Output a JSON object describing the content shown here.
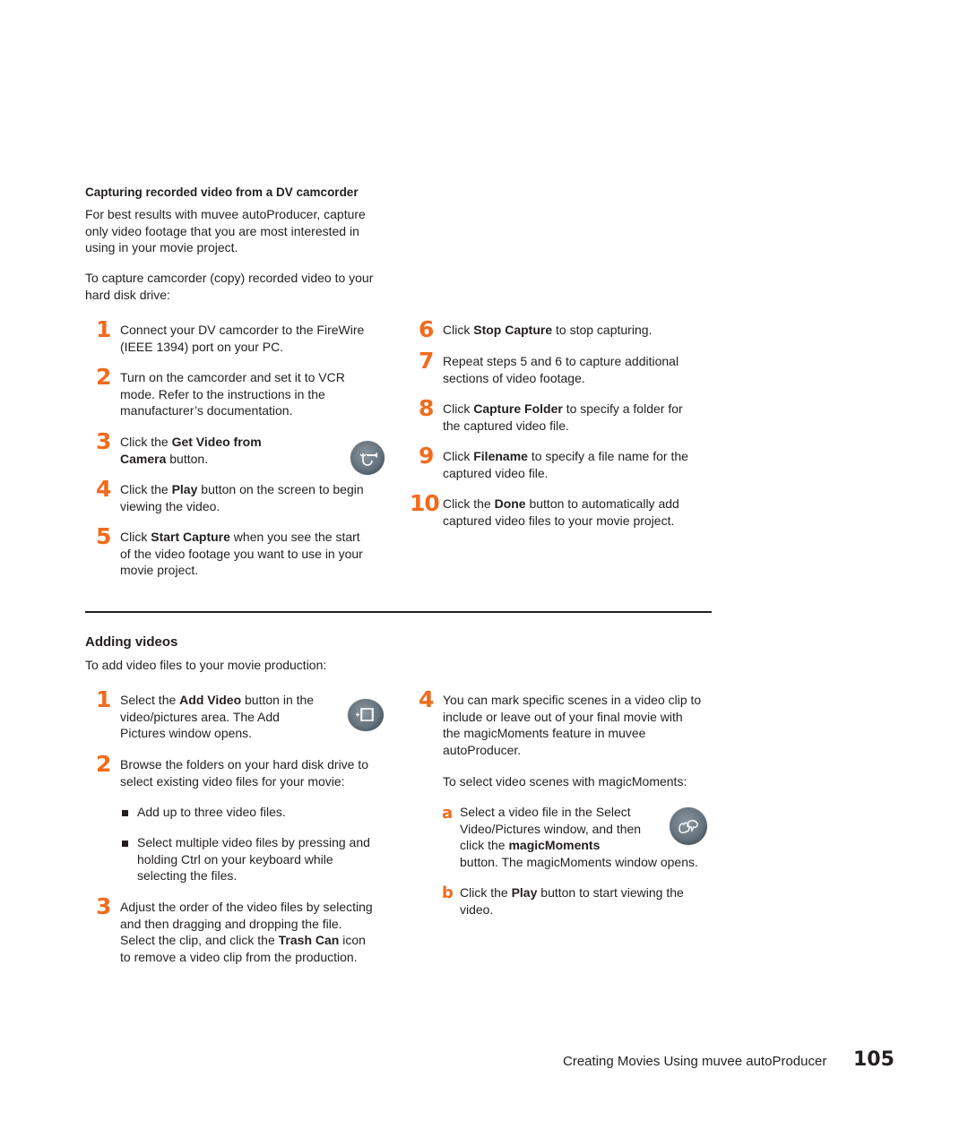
{
  "section1": {
    "heading": "Capturing recorded video from a DV camcorder",
    "intro_lines": [
      "For best results with muvee autoProducer, capture",
      "only video footage that you are most interested in",
      "using in your movie project."
    ],
    "lead_lines": [
      "To capture camcorder (copy) recorded video to your",
      "hard disk drive:"
    ],
    "steps": [
      {
        "num": "1",
        "lines": [
          [
            {
              "t": "Connect your DV camcorder to the FireWire"
            }
          ],
          [
            {
              "t": "(IEEE 1394) port on your PC."
            }
          ]
        ]
      },
      {
        "num": "2",
        "lines": [
          [
            {
              "t": "Turn on the camcorder and set it to VCR"
            }
          ],
          [
            {
              "t": "mode. Refer to the instructions in the"
            }
          ],
          [
            {
              "t": "manufacturer’s documentation."
            }
          ]
        ]
      },
      {
        "num": "3",
        "lines": [
          [
            {
              "t": "Click the "
            },
            {
              "t": "Get Video from",
              "b": true
            }
          ],
          [
            {
              "t": "Camera",
              "b": true
            },
            {
              "t": " button."
            }
          ]
        ]
      },
      {
        "num": "4",
        "lines": [
          [
            {
              "t": "Click the "
            },
            {
              "t": "Play",
              "b": true
            },
            {
              "t": " button on the screen to begin"
            }
          ],
          [
            {
              "t": "viewing the video."
            }
          ]
        ]
      },
      {
        "num": "5",
        "lines": [
          [
            {
              "t": "Click "
            },
            {
              "t": "Start Capture",
              "b": true
            },
            {
              "t": " when you see the start"
            }
          ],
          [
            {
              "t": "of the video footage you want to use in your"
            }
          ],
          [
            {
              "t": "movie project."
            }
          ]
        ]
      },
      {
        "num": "6",
        "lines": [
          [
            {
              "t": "Click "
            },
            {
              "t": "Stop Capture",
              "b": true
            },
            {
              "t": " to stop capturing."
            }
          ]
        ]
      },
      {
        "num": "7",
        "lines": [
          [
            {
              "t": "Repeat steps 5 and 6 to capture additional"
            }
          ],
          [
            {
              "t": "sections of video footage."
            }
          ]
        ]
      },
      {
        "num": "8",
        "lines": [
          [
            {
              "t": "Click "
            },
            {
              "t": "Capture Folder",
              "b": true
            },
            {
              "t": " to specify a folder for"
            }
          ],
          [
            {
              "t": "the captured video file."
            }
          ]
        ]
      },
      {
        "num": "9",
        "lines": [
          [
            {
              "t": "Click "
            },
            {
              "t": "Filename",
              "b": true
            },
            {
              "t": " to specify a file name for the"
            }
          ],
          [
            {
              "t": "captured video file."
            }
          ]
        ]
      },
      {
        "num": "10",
        "lines": [
          [
            {
              "t": "Click the "
            },
            {
              "t": "Done",
              "b": true
            },
            {
              "t": " button to automatically add"
            }
          ],
          [
            {
              "t": "captured video files to your movie project."
            }
          ]
        ]
      }
    ],
    "icon": "get-video-from-camera-icon"
  },
  "section2": {
    "heading": "Adding videos",
    "lead": "To add video files to your movie production:",
    "steps": [
      {
        "num": "1",
        "lines": [
          [
            {
              "t": "Select the "
            },
            {
              "t": "Add Video",
              "b": true
            },
            {
              "t": " button in the"
            }
          ],
          [
            {
              "t": "video/pictures area. The Add"
            }
          ],
          [
            {
              "t": "Pictures window opens."
            }
          ]
        ]
      },
      {
        "num": "2",
        "lines": [
          [
            {
              "t": "Browse the folders on your hard disk drive to"
            }
          ],
          [
            {
              "t": "select existing video files for your movie:"
            }
          ]
        ]
      },
      {
        "num": "3",
        "lines": [
          [
            {
              "t": "Adjust the order of the video files by selecting"
            }
          ],
          [
            {
              "t": "and then dragging and dropping the file."
            }
          ],
          [
            {
              "t": "Select the clip, and click the "
            },
            {
              "t": "Trash Can",
              "b": true
            },
            {
              "t": " icon"
            }
          ],
          [
            {
              "t": "to remove a video clip from the production."
            }
          ]
        ]
      },
      {
        "num": "4",
        "lines": [
          [
            {
              "t": "You can mark specific scenes in a video clip to"
            }
          ],
          [
            {
              "t": "include or leave out of your final movie with"
            }
          ],
          [
            {
              "t": "the magicMoments feature in muvee"
            }
          ],
          [
            {
              "t": "autoProducer."
            }
          ]
        ]
      }
    ],
    "bullets": [
      {
        "lines": [
          "Add up to three video files."
        ]
      },
      {
        "lines": [
          "Select multiple video files by pressing and",
          "holding Ctrl on your keyboard while",
          "selecting the files."
        ]
      }
    ],
    "magic_lead": "To select video scenes with magicMoments:",
    "substeps": [
      {
        "letter": "a",
        "lines": [
          [
            {
              "t": "Select a video file in the Select"
            }
          ],
          [
            {
              "t": "Video/Pictures window, and then"
            }
          ],
          [
            {
              "t": "click the "
            },
            {
              "t": "magicMoments",
              "b": true
            }
          ],
          [
            {
              "t": "button. The magicMoments window opens."
            }
          ]
        ]
      },
      {
        "letter": "b",
        "lines": [
          [
            {
              "t": "Click the "
            },
            {
              "t": "Play",
              "b": true
            },
            {
              "t": " button to start viewing the"
            }
          ],
          [
            {
              "t": "video."
            }
          ]
        ]
      }
    ],
    "icons": [
      "add-video-icon",
      "magic-moments-icon"
    ]
  },
  "footer": {
    "chapter": "Creating Movies Using muvee autoProducer",
    "page_number": "105"
  },
  "colors": {
    "accent": "#f26b1d",
    "text": "#231f20"
  }
}
